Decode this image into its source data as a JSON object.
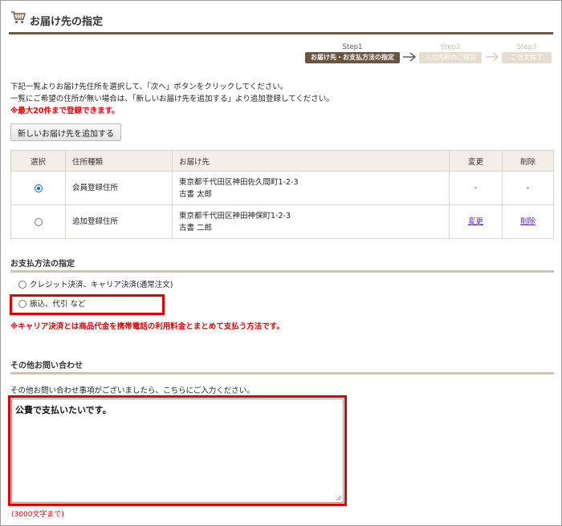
{
  "header": {
    "title": "お届け先の指定",
    "icon": "cart-icon"
  },
  "steps": [
    {
      "num": "Step1",
      "label": "お届け先・お支払方法の指定",
      "active": true
    },
    {
      "num": "Step2",
      "label": "入力内容のご確認",
      "active": false
    },
    {
      "num": "Step3",
      "label": "ご注文完了",
      "active": false
    }
  ],
  "intro": {
    "line1": "下記一覧よりお届け先住所を選択して、「次へ」ボタンをクリックしてください。",
    "line2": "一覧にご希望の住所が無い場合は、「新しいお届け先を追加する」より追加登録してください。",
    "warning": "※最大20件まで登録できます。"
  },
  "add_button": "新しいお届け先を追加する",
  "address_table": {
    "headers": {
      "select": "選択",
      "type": "住所種類",
      "dest": "お届け先",
      "edit": "変更",
      "delete": "削除"
    },
    "rows": [
      {
        "selected": true,
        "type": "会員登録住所",
        "address": "東京都千代田区神田佐久間町1-2-3",
        "name": "古書 太郎",
        "edit": "-",
        "delete": "-"
      },
      {
        "selected": false,
        "type": "追加登録住所",
        "address": "東京都千代田区神田神保町1-2-3",
        "name": "古書 二郎",
        "edit": "変更",
        "delete": "削除"
      }
    ]
  },
  "payment": {
    "title": "お支払方法の指定",
    "options": [
      {
        "label": "クレジット決済、キャリア決済(通常注文)",
        "selected": false
      },
      {
        "label": "振込、代引 など",
        "selected": false
      }
    ],
    "note": "※キャリア決済とは商品代金を携帯電話の利用料金とまとめて支払う方法です。"
  },
  "inquiry": {
    "title": "その他お問い合わせ",
    "description": "その他お問い合わせ事項がございましたら、こちらにご入力ください。",
    "value": "公費で支払いたいです。",
    "limit": "(3000文字まで)"
  },
  "colors": {
    "accent": "#6a5540",
    "warning": "#e60000",
    "highlight": "#e00000"
  }
}
